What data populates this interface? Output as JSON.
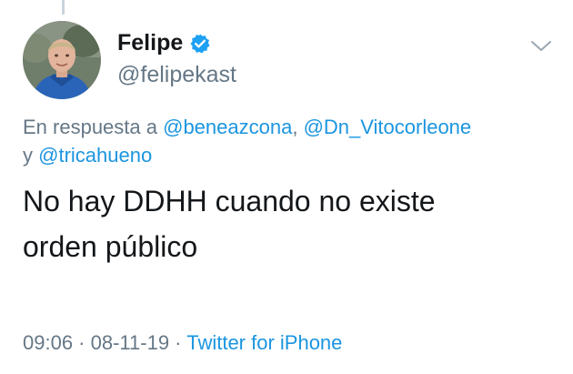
{
  "author": {
    "display_name": "Felipe",
    "handle": "@felipekast",
    "verified": true,
    "avatar_icon": "profile-photo"
  },
  "reply": {
    "prefix": "En respuesta a",
    "mentions": [
      "@beneazcona",
      "@Dn_Vitocorleone",
      "@tricahueno"
    ],
    "sep1": ", ",
    "sep2": "y "
  },
  "tweet": {
    "line1": "No hay DDHH cuando no existe",
    "line2": "orden público"
  },
  "meta": {
    "time": "09:06",
    "dot": " · ",
    "date": "08-11-19",
    "source": "Twitter for iPhone"
  },
  "colors": {
    "link": "#1b95e0",
    "muted": "#657786",
    "text": "#14171a",
    "verified": "#1da1f2"
  },
  "icons": [
    "verified-badge-icon",
    "chevron-down-icon"
  ]
}
